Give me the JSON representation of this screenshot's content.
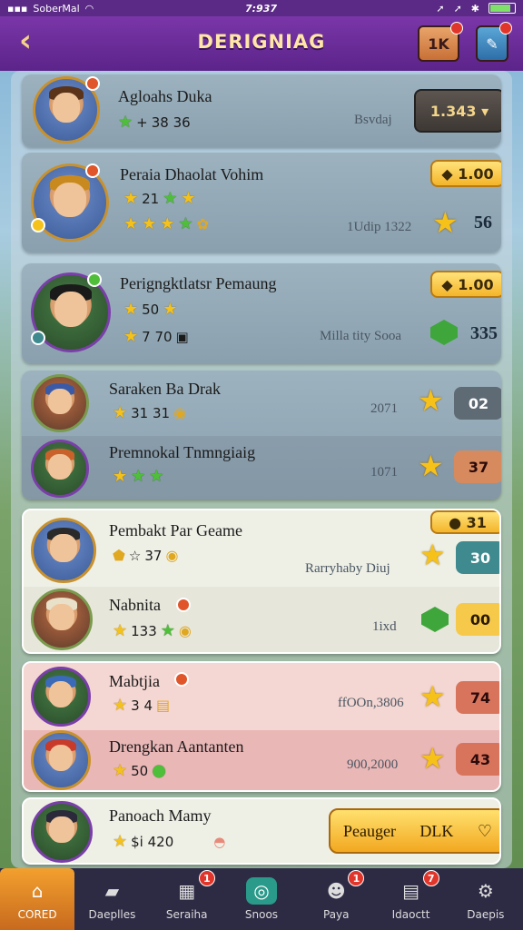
{
  "status": {
    "carrier": "SoberMal",
    "time": "7:937"
  },
  "header": {
    "title": "DERIGNIAG",
    "badge_a_label": "1K"
  },
  "rows": [
    {
      "name": "Agloahs Duka",
      "stats": "38 36",
      "label": "Bsvdaj",
      "value": "1.343"
    },
    {
      "name": "Peraia Dhaolat Vohim",
      "stats_top": "21",
      "label": "1Udip 1322",
      "pill": "1.00",
      "value": "56"
    },
    {
      "name": "Perigngktlatsr Pemaung",
      "stats_top": "50",
      "stats_bottom": "7 70",
      "label": "Milla tity Sooa",
      "pill": "1.00",
      "value": "335"
    },
    {
      "name": "Saraken Ba Drak",
      "stats": "31 31",
      "label": "2071",
      "value": "02"
    },
    {
      "name": "Premnokal Tnmngiaig",
      "label": "1071",
      "value": "37"
    },
    {
      "name": "Pembakt Par Geame",
      "stats": "37",
      "label": "Rarryhaby Diuj",
      "pill": "31",
      "value": "30"
    },
    {
      "name": "Nabnita",
      "stats": "133",
      "label": "1ixd",
      "value": "00"
    },
    {
      "name": "Mabtjia",
      "stats": "3 4",
      "label": "ffOOn,3806",
      "value": "74"
    },
    {
      "name": "Drengkan Aantanten",
      "stats": "50",
      "label": "900,2000",
      "value": "43"
    },
    {
      "name": "Panoach Mamy",
      "stats": "$i 420",
      "cta_left": "Peauger",
      "cta_right": "DLK"
    }
  ],
  "nav": [
    {
      "label": "CORED",
      "icon": "home-icon",
      "badge": ""
    },
    {
      "label": "Daeplles",
      "icon": "card-icon",
      "badge": ""
    },
    {
      "label": "Seraiha",
      "icon": "chest-icon",
      "badge": "1"
    },
    {
      "label": "Snoos",
      "icon": "circle-icon",
      "badge": ""
    },
    {
      "label": "Paya",
      "icon": "face-icon",
      "badge": "1"
    },
    {
      "label": "Idaoctt",
      "icon": "box-icon",
      "badge": "7"
    },
    {
      "label": "Daepis",
      "icon": "gear-icon",
      "badge": ""
    }
  ]
}
